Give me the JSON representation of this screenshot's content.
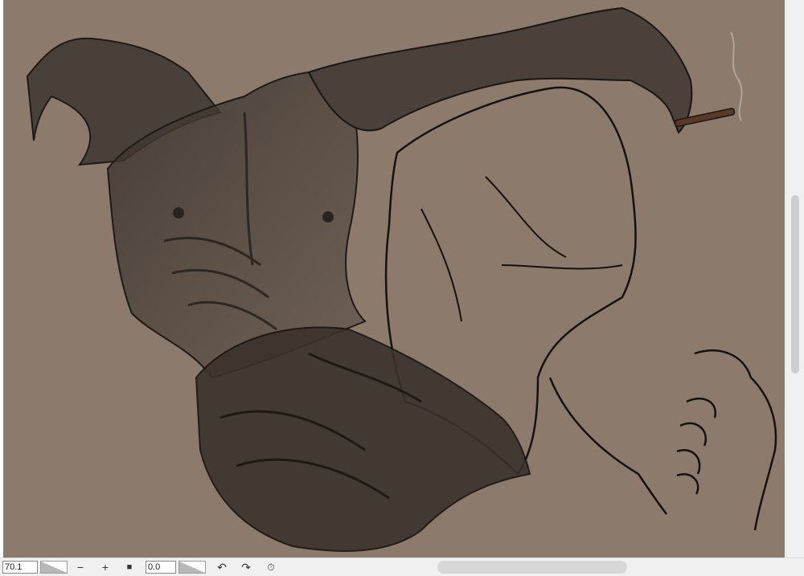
{
  "statusbar": {
    "zoom_value": "70.1",
    "rotation_value": "0.0",
    "zoom_out_label": "−",
    "zoom_in_label": "+",
    "fit_label": "■",
    "rotate_left_label": "↶",
    "rotate_right_label": "↷",
    "reset_rotation_label": "⏱"
  },
  "colors": {
    "canvas_paper": "#8c7b6d",
    "chrome": "#f0f0f0",
    "scroll_thumb": "#cdcdcd"
  }
}
